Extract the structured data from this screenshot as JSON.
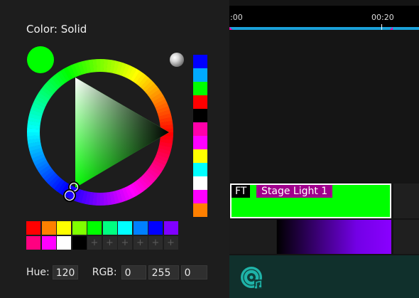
{
  "picker": {
    "title": "Color: Solid",
    "current_color": "#00ff00",
    "strip_colors": [
      "#0000ff",
      "#00aaff",
      "#00ff00",
      "#ff0000",
      "#000000",
      "#ff00aa",
      "#ff00ff",
      "#ffff00",
      "#00ffff",
      "#ffffff",
      "#ff00ff",
      "#ff7f00"
    ],
    "swatches_row1": [
      "#ff0000",
      "#ff8000",
      "#ffff00",
      "#80ff00",
      "#00ff00",
      "#00ff80",
      "#00ffff",
      "#0080ff",
      "#0000ff",
      "#8000ff"
    ],
    "swatches_row2": [
      "#ff0080",
      "#ff00ff",
      "#ffffff",
      "#000000",
      "",
      "",
      "",
      "",
      "",
      ""
    ],
    "empty_symbol": "+",
    "hue_label": "Hue:",
    "hue_value": "120",
    "rgb_label": "RGB:",
    "rgb_r": "0",
    "rgb_g": "255",
    "rgb_b": "0"
  },
  "timeline": {
    "time_start": ":00",
    "time_mark": "00:20",
    "clip_tag": "FT",
    "clip_name": "Stage Light 1",
    "clip_color": "#00ff00"
  },
  "icons": {
    "eyedropper": "eyedropper-icon",
    "disc": "music-disc-icon"
  }
}
